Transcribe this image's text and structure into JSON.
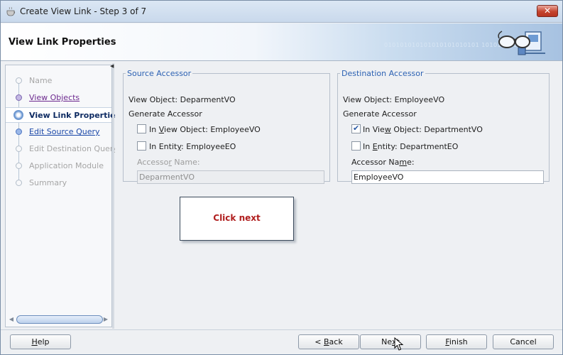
{
  "window": {
    "title": "Create View Link - Step 3 of 7",
    "close_label": "✕"
  },
  "header": {
    "title": "View Link Properties",
    "binary_decor": "010101010101010101010101\n1010101010"
  },
  "nav": {
    "items": [
      {
        "label": "Name",
        "state": "disabled"
      },
      {
        "label": "View Objects",
        "state": "visited"
      },
      {
        "label": "View Link Properties",
        "state": "current"
      },
      {
        "label": "Edit Source Query",
        "state": "link"
      },
      {
        "label": "Edit Destination Query",
        "state": "disabled"
      },
      {
        "label": "Application Module",
        "state": "disabled"
      },
      {
        "label": "Summary",
        "state": "disabled"
      }
    ]
  },
  "source": {
    "legend": "Source Accessor",
    "view_object": "View Object: DeparmentVO",
    "generate_accessor": "Generate Accessor",
    "in_view_object_pre": "In ",
    "in_view_object_mn": "V",
    "in_view_object_post": "iew Object: EmployeeVO",
    "in_view_object_checked": false,
    "in_entity_pre": "In Entit",
    "in_entity_mn": "y",
    "in_entity_post": ": EmployeeEO",
    "in_entity_checked": false,
    "accessor_name_pre": "Accesso",
    "accessor_name_mn": "r",
    "accessor_name_post": " Name:",
    "accessor_value": "DeparmentVO"
  },
  "destination": {
    "legend": "Destination Accessor",
    "view_object": "View Object: EmployeeVO",
    "generate_accessor": "Generate Accessor",
    "in_view_object_pre": "In Vie",
    "in_view_object_mn": "w",
    "in_view_object_post": " Object: DepartmentVO",
    "in_view_object_checked": true,
    "in_entity_pre": "In ",
    "in_entity_mn": "E",
    "in_entity_post": "ntity: DepartmentEO",
    "in_entity_checked": false,
    "accessor_name_pre": "Accessor Na",
    "accessor_name_mn": "m",
    "accessor_name_post": "e:",
    "accessor_value": "EmployeeVO"
  },
  "callout": {
    "text": "Click next"
  },
  "buttons": {
    "help_mn": "H",
    "help_rest": "elp",
    "back_pre": "< ",
    "back_mn": "B",
    "back_rest": "ack",
    "next_pre": "Ne",
    "next_mn": "x",
    "next_rest": "t",
    "finish_mn": "F",
    "finish_rest": "inish",
    "cancel": "Cancel"
  }
}
